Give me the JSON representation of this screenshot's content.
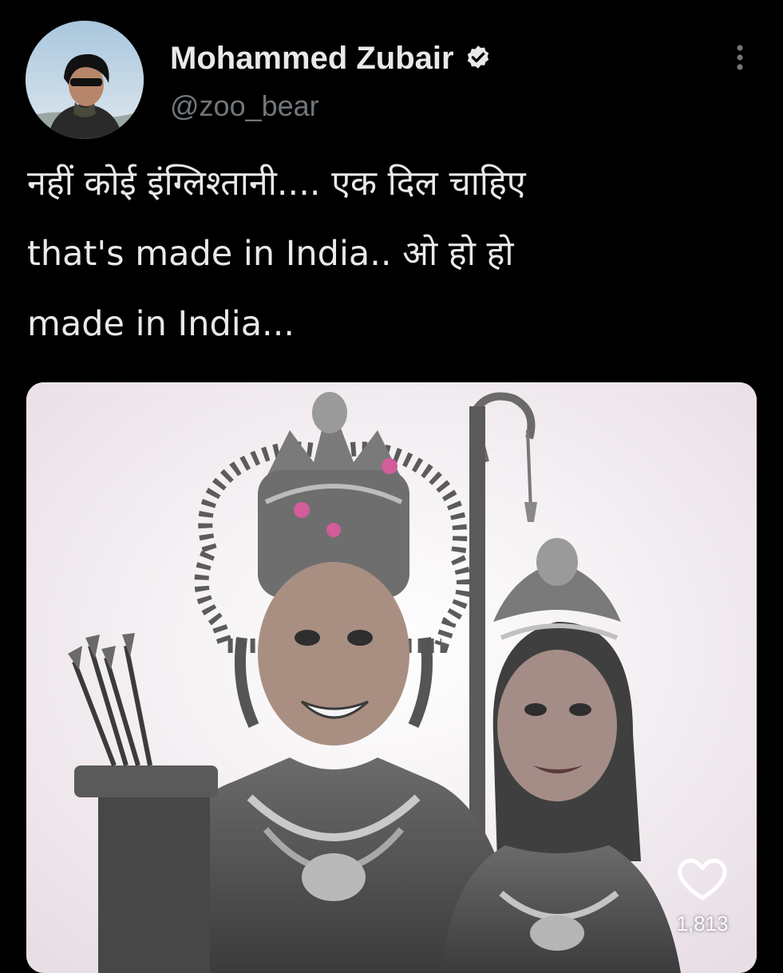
{
  "author": {
    "display_name": "Mohammed Zubair",
    "handle": "@zoo_bear",
    "verified": true,
    "avatar_icon": "profile-photo"
  },
  "more_icon": "more-vertical-icon",
  "tweet": {
    "lines": [
      "नहीं कोई इंग्लिश्तानी.... एक दिल चाहिए",
      "that's made in India.. ओ हो हो",
      "made in India..."
    ]
  },
  "media": {
    "like_icon": "heart-icon",
    "like_count": "1,813"
  },
  "colors": {
    "background": "#000000",
    "text_primary": "#e7e9ea",
    "text_secondary": "#71767b",
    "verified_badge": "#e7e9ea"
  }
}
